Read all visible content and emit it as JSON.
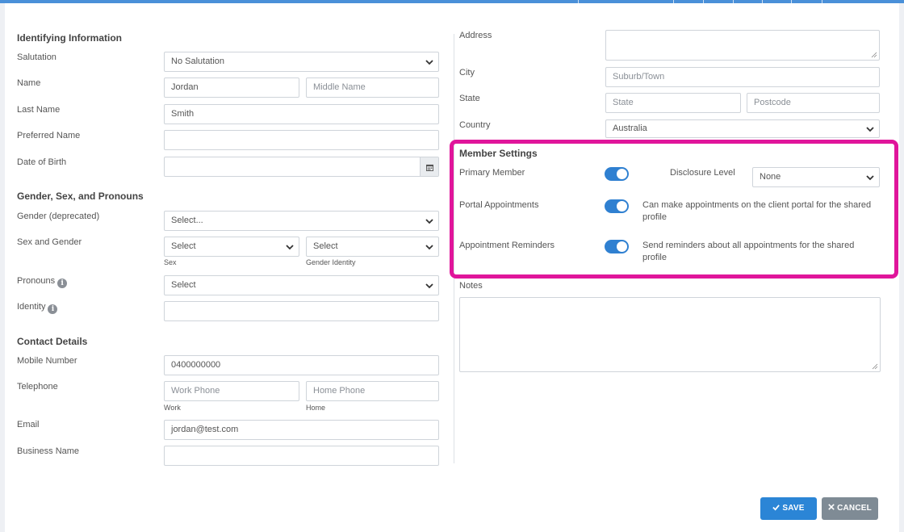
{
  "left": {
    "identifying": {
      "heading": "Identifying Information",
      "salutation_label": "Salutation",
      "salutation_value": "No Salutation",
      "name_label": "Name",
      "first_name": "Jordan",
      "middle_placeholder": "Middle Name",
      "last_name_label": "Last Name",
      "last_name": "Smith",
      "preferred_label": "Preferred Name",
      "dob_label": "Date of Birth"
    },
    "gender": {
      "heading": "Gender, Sex, and Pronouns",
      "gender_label": "Gender (deprecated)",
      "gender_value": "Select...",
      "sex_gender_label": "Sex and Gender",
      "sex_value": "Select",
      "sex_sub": "Sex",
      "gender_identity_value": "Select",
      "gender_identity_sub": "Gender Identity",
      "pronouns_label": "Pronouns",
      "pronouns_value": "Select",
      "identity_label": "Identity"
    },
    "contact": {
      "heading": "Contact Details",
      "mobile_label": "Mobile Number",
      "mobile_value": "0400000000",
      "telephone_label": "Telephone",
      "work_placeholder": "Work Phone",
      "work_sub": "Work",
      "home_placeholder": "Home Phone",
      "home_sub": "Home",
      "email_label": "Email",
      "email_value": "jordan@test.com",
      "business_label": "Business Name"
    }
  },
  "right": {
    "address_label": "Address",
    "city_label": "City",
    "city_placeholder": "Suburb/Town",
    "state_label": "State",
    "state_placeholder": "State",
    "postcode_placeholder": "Postcode",
    "country_label": "Country",
    "country_value": "Australia",
    "member": {
      "heading": "Member Settings",
      "primary_label": "Primary Member",
      "primary_on": true,
      "disclosure_label": "Disclosure Level",
      "disclosure_value": "None",
      "portal_label": "Portal Appointments",
      "portal_on": true,
      "portal_desc": "Can make appointments on the client portal for the shared profile",
      "reminders_label": "Appointment Reminders",
      "reminders_on": true,
      "reminders_desc": "Send reminders about all appointments for the shared profile"
    },
    "notes_label": "Notes"
  },
  "footer": {
    "save_label": "SAVE",
    "cancel_label": "CANCEL"
  },
  "colors": {
    "accent": "#2b85d6",
    "highlight": "#e0159b",
    "cancel": "#7f8b95"
  },
  "icons": {
    "select": "chevron-down-icon",
    "date": "calendar-icon",
    "info": "info-icon",
    "save": "check-icon",
    "cancel": "x-icon"
  }
}
